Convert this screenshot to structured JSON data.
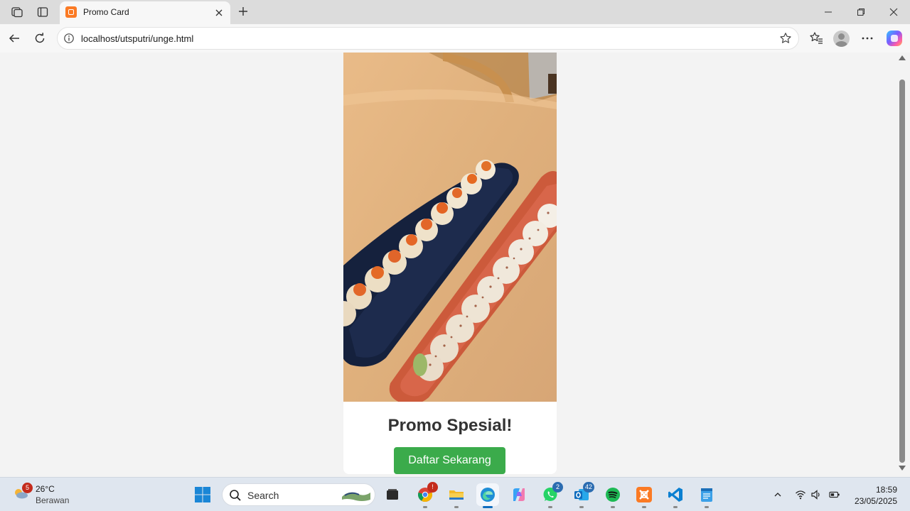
{
  "browser": {
    "tab": {
      "title": "Promo Card",
      "favicon": "xampp-icon"
    },
    "address_bar": {
      "url": "localhost/utsputri/unge.html"
    }
  },
  "page": {
    "image": {
      "subject": "sushi-rolls-on-plates-photo"
    },
    "title": "Promo Spesial!",
    "cta_label": "Daftar Sekarang",
    "colors": {
      "background": "#f3f3f3",
      "card": "#ffffff",
      "title": "#333333",
      "button": "#3bab4b"
    }
  },
  "taskbar": {
    "weather": {
      "temperature": "26°C",
      "condition": "Berawan",
      "badge": "5"
    },
    "search_placeholder": "Search",
    "badges": {
      "whatsapp": "2",
      "outlook": "42"
    },
    "clock": {
      "time": "18:59",
      "date": "23/05/2025"
    }
  }
}
